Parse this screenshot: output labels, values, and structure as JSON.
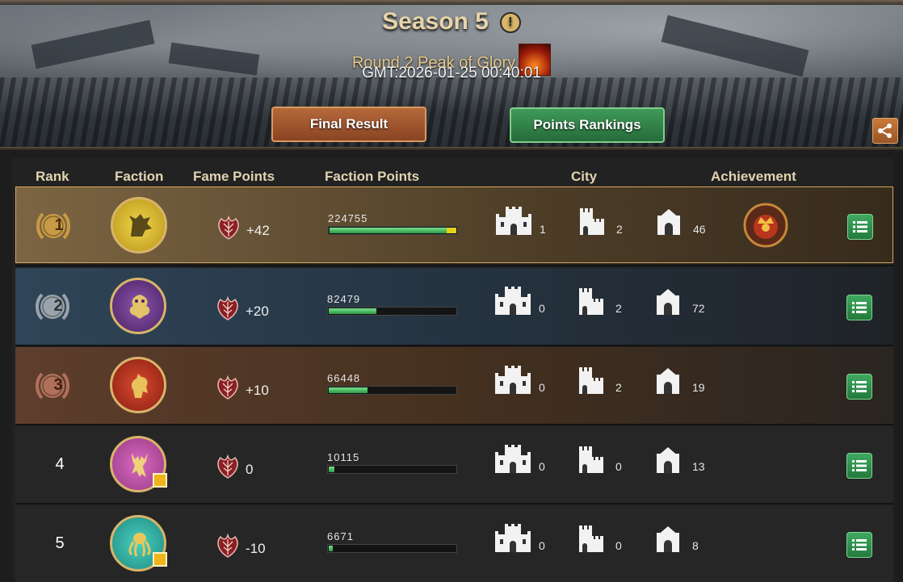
{
  "header": {
    "season_title": "Season 5",
    "info_icon": "exclamation-info-icon",
    "round_title": "Round 2 Peak of Glory",
    "round_icon": "volcano-fire-icon",
    "gmt_time": "GMT:2026-01-25 00:40:01",
    "final_result_label": "Final Result",
    "points_rankings_label": "Points Rankings",
    "share_icon": "share-icon"
  },
  "columns": {
    "rank": "Rank",
    "faction": "Faction",
    "fame_points": "Fame Points",
    "faction_points": "Faction Points",
    "city": "City",
    "achievement": "Achievement"
  },
  "colors": {
    "gold_accent": "#d3a85a",
    "green_button": "#2f8a4a",
    "bronze_button": "#a3582f",
    "progress_green": "#2b9a45",
    "progress_cap": "#e7d21a"
  },
  "rows": [
    {
      "rank": "1",
      "rank_style": "gold-laurel-badge",
      "faction_icon": "wolf-crest-icon",
      "faction_color": "#d4b42a",
      "fame": "+42",
      "faction_points": "224755",
      "progress": 0.92,
      "city_a": "1",
      "city_b": "2",
      "city_c": "46",
      "achievement": "flaming-crown-medal-icon"
    },
    {
      "rank": "2",
      "rank_style": "silver-laurel-badge",
      "faction_icon": "dragon-crest-icon",
      "faction_color": "#6a3a8a",
      "fame": "+20",
      "faction_points": "82479",
      "progress": 0.37,
      "city_a": "0",
      "city_b": "2",
      "city_c": "72"
    },
    {
      "rank": "3",
      "rank_style": "bronze-laurel-badge",
      "faction_icon": "lion-crest-icon",
      "faction_color": "#b8321f",
      "fame": "+10",
      "faction_points": "66448",
      "progress": 0.3,
      "city_a": "0",
      "city_b": "2",
      "city_c": "19"
    },
    {
      "rank": "4",
      "faction_icon": "stag-crest-icon",
      "faction_color": "#c058a8",
      "fame": "0",
      "faction_points": "10115",
      "progress": 0.045,
      "city_a": "0",
      "city_b": "0",
      "city_c": "13"
    },
    {
      "rank": "5",
      "faction_icon": "kraken-crest-icon",
      "faction_color": "#2fb8a8",
      "fame": "-10",
      "faction_points": "6671",
      "progress": 0.03,
      "city_a": "0",
      "city_b": "0",
      "city_c": "8"
    }
  ]
}
